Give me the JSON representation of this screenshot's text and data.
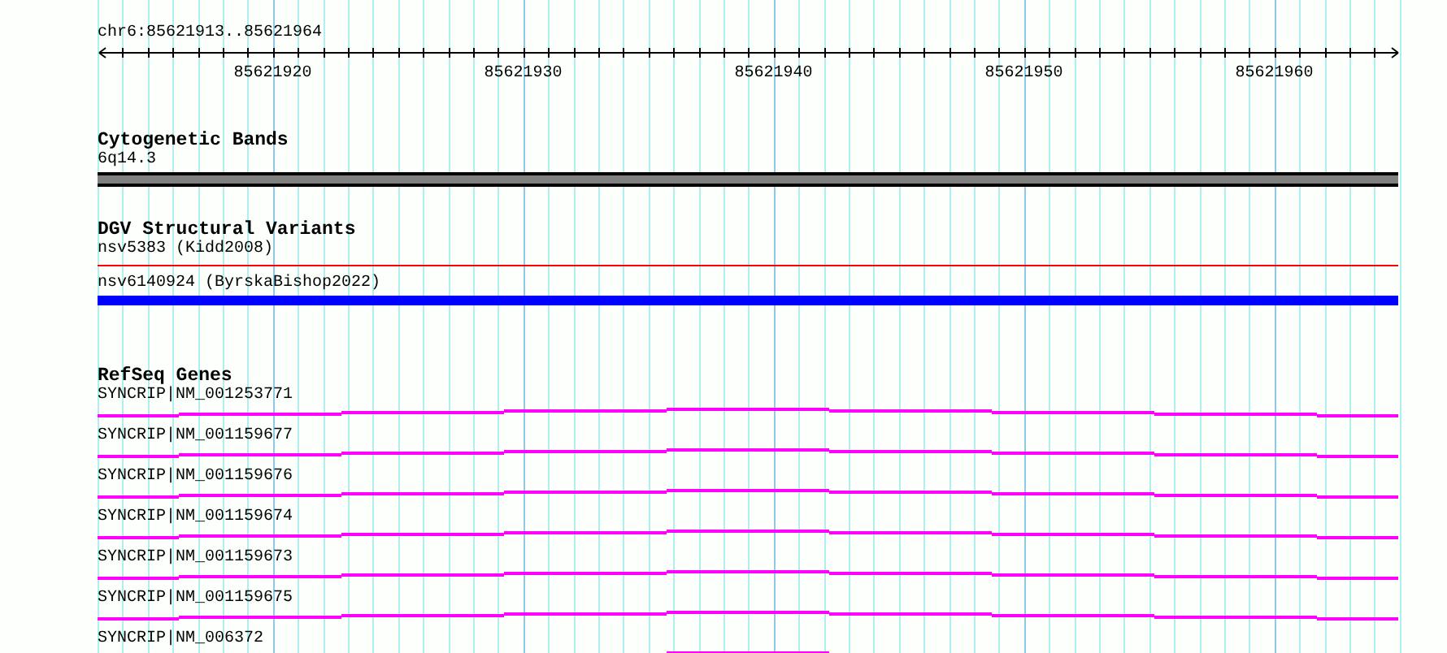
{
  "ruler": {
    "label": "chr6:85621913..85621964",
    "ticks": [
      "85621920",
      "85621930",
      "85621940",
      "85621950",
      "85621960"
    ]
  },
  "tracks": [
    {
      "title": "Cytogenetic Bands",
      "kind": "band",
      "features": [
        {
          "label": "6q14.3"
        }
      ]
    },
    {
      "title": "DGV Structural Variants",
      "kind": "variant",
      "features": [
        {
          "label": "nsv5383 (Kidd2008)",
          "kind": "line",
          "color": "#ff0000"
        },
        {
          "label": "nsv6140924 (ByrskaBishop2022)",
          "kind": "bar",
          "color": "#0000ff"
        }
      ]
    },
    {
      "title": "RefSeq Genes",
      "kind": "gene",
      "features": [
        {
          "label": "SYNCRIP|NM_001253771"
        },
        {
          "label": "SYNCRIP|NM_001159677"
        },
        {
          "label": "SYNCRIP|NM_001159676"
        },
        {
          "label": "SYNCRIP|NM_001159674"
        },
        {
          "label": "SYNCRIP|NM_001159673"
        },
        {
          "label": "SYNCRIP|NM_001159675"
        },
        {
          "label": "SYNCRIP|NM_006372"
        }
      ]
    }
  ]
}
